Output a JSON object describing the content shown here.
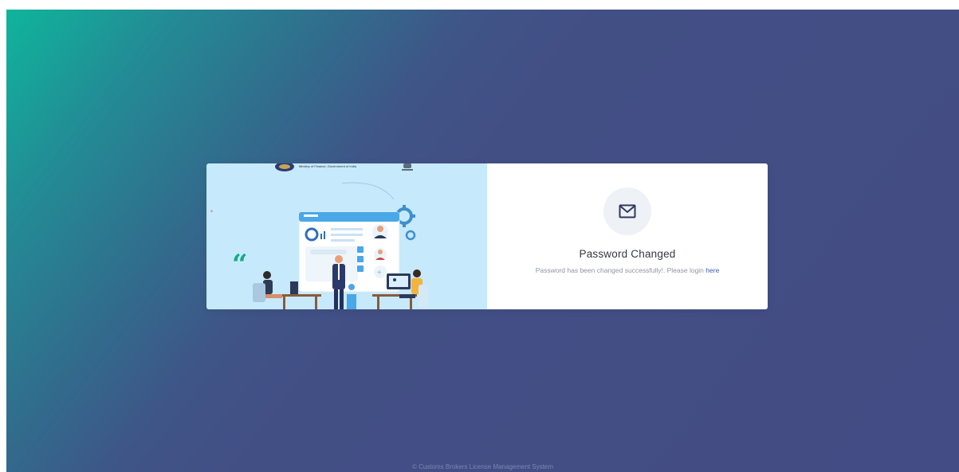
{
  "illustration": {
    "header_caption": "Ministry of Finance, Government of India"
  },
  "message": {
    "icon": "mail-icon",
    "title": "Password Changed",
    "text": "Password has been changed successfully!. Please login ",
    "link_label": "here"
  },
  "footer": {
    "text": "© Customs Brokers License Management System"
  },
  "colors": {
    "gradient_start": "#0fb59c",
    "gradient_end": "#434c84",
    "illustration_bg": "#c6e9fb",
    "link": "#3f5fa8",
    "quote_mark": "#14a98b"
  }
}
